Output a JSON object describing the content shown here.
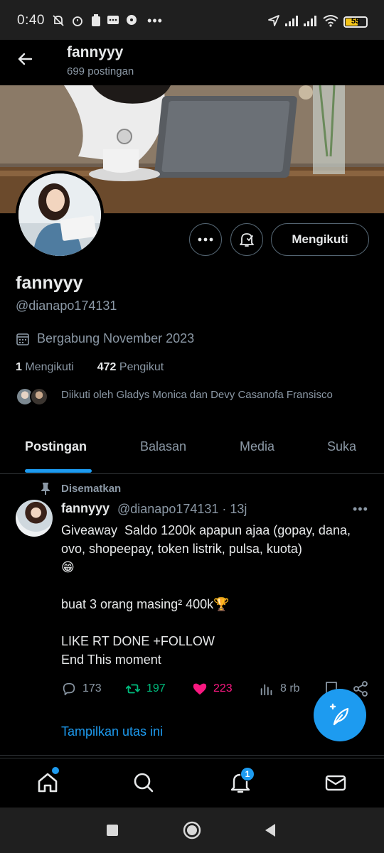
{
  "status_bar": {
    "time": "0:40",
    "battery": "55"
  },
  "header": {
    "title": "fannyyy",
    "subtitle": "699 postingan"
  },
  "profile": {
    "name": "fannyyy",
    "handle": "@dianapo174131",
    "joined": "Bergabung November 2023",
    "following_count": "1",
    "following_label": "Mengikuti",
    "followers_count": "472",
    "followers_label": "Pengikut",
    "followed_by": "Diikuti oleh Gladys Monica dan Devy Casanofa Fransisco",
    "follow_button": "Mengikuti"
  },
  "tabs": [
    {
      "label": "Postingan",
      "active": true
    },
    {
      "label": "Balasan",
      "active": false
    },
    {
      "label": "Media",
      "active": false
    },
    {
      "label": "Suka",
      "active": false
    }
  ],
  "tweet": {
    "pinned_label": "Disematkan",
    "author_name": "fannyyy",
    "meta": "@dianapo174131 · 13j",
    "body": "Giveaway  Saldo 1200k apapun ajaa (gopay, dana, ovo, shopeepay, token listrik, pulsa, kuota)\n😁\n\nbuat 3 orang masing² 400k🏆\n\nLIKE RT DONE +FOLLOW\nEnd This moment",
    "replies": "173",
    "retweets": "197",
    "likes": "223",
    "views": "8 rb",
    "show_thread": "Tampilkan utas ini"
  },
  "bottom_nav": {
    "notification_badge": "1"
  },
  "colors": {
    "accent": "#1d9bf0",
    "retweet": "#00ba7c",
    "like": "#f91880",
    "muted": "#8b98a5"
  }
}
